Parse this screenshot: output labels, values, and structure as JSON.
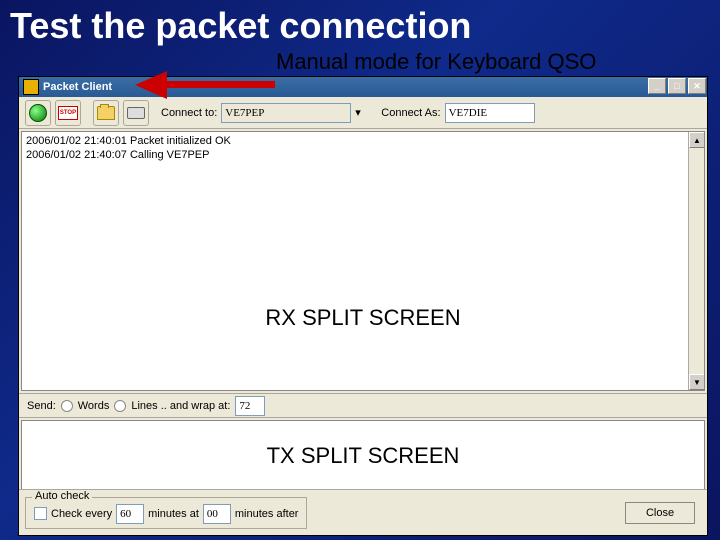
{
  "slide": {
    "title": "Test the packet connection",
    "subtitle": "Manual mode for Keyboard QSO"
  },
  "window": {
    "title": "Packet Client"
  },
  "toolbar": {
    "connect_to_label": "Connect to:",
    "connect_to_value": "VE7PEP",
    "connect_as_label": "Connect As:",
    "connect_as_value": "VE7DIE",
    "stop_label": "STOP"
  },
  "rx": {
    "log": [
      "2006/01/02 21:40:01 Packet initialized OK",
      "2006/01/02 21:40:07 Calling VE7PEP"
    ],
    "overlay": "RX SPLIT SCREEN"
  },
  "send": {
    "label": "Send:",
    "opt_words": "Words",
    "opt_lines": "Lines ..  and wrap at:",
    "wrap_value": "72"
  },
  "tx": {
    "overlay": "TX SPLIT SCREEN"
  },
  "footer": {
    "group_label": "Auto check",
    "check_label": "Check every",
    "minutes_value": "60",
    "minutes_at_label": "minutes at",
    "after_value": "00",
    "after_label": "minutes after",
    "close": "Close"
  }
}
